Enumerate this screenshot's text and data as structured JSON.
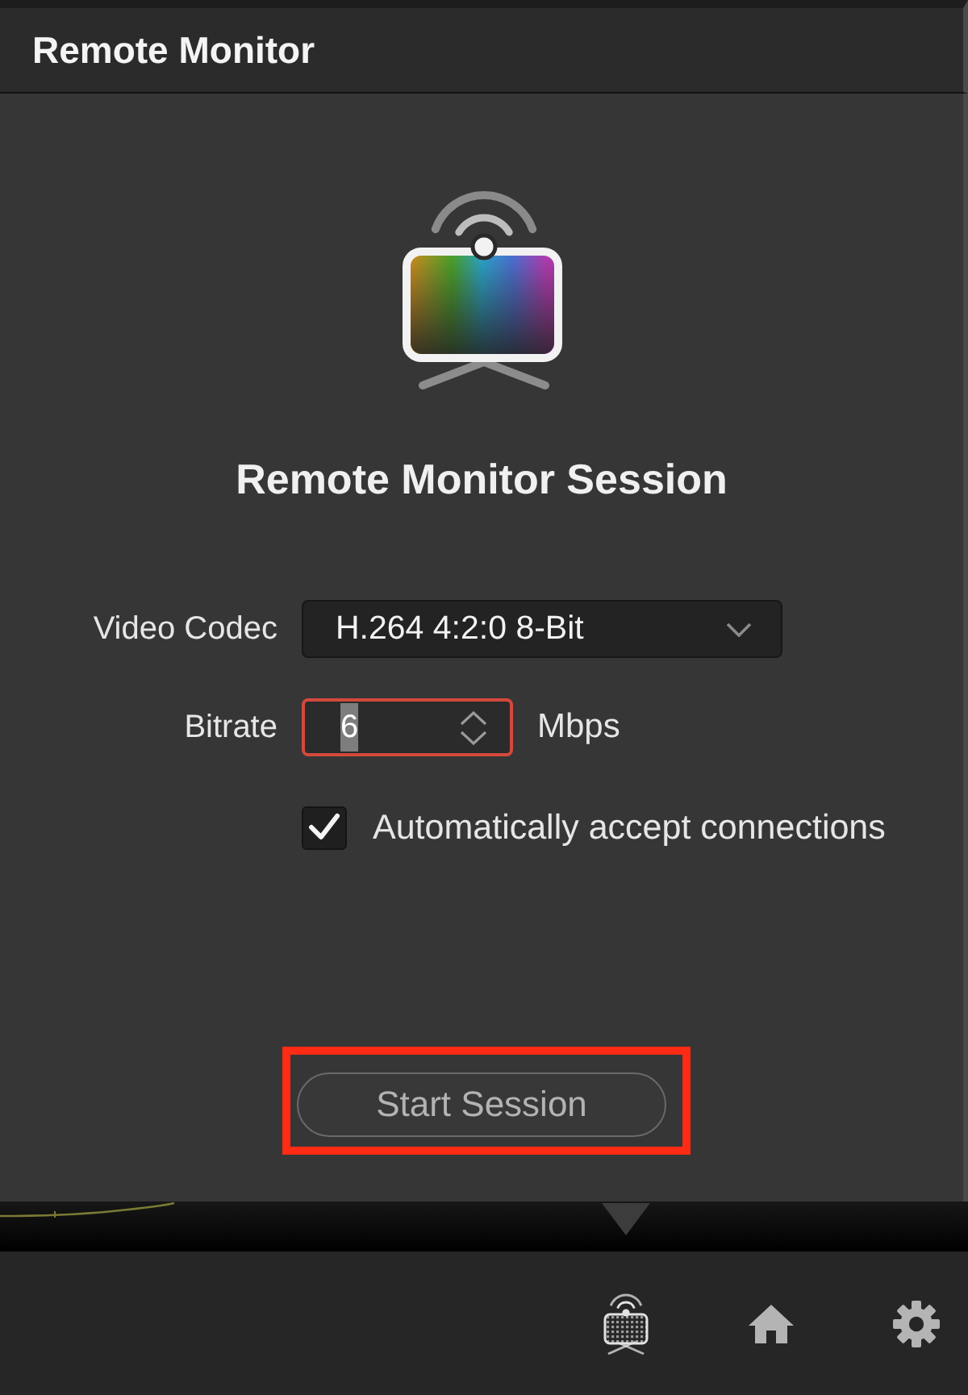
{
  "panel": {
    "title": "Remote Monitor",
    "heading": "Remote Monitor Session"
  },
  "fields": [
    {
      "kind": "select",
      "label": "Video Codec",
      "value": "H.264 4:2:0 8-Bit"
    },
    {
      "kind": "number",
      "label": "Bitrate",
      "value": "6",
      "unit": "Mbps",
      "focused": true
    }
  ],
  "options": [
    {
      "label": "Automatically accept connections",
      "checked": true
    }
  ],
  "start_button": {
    "label": "Start Session",
    "highlighted": true
  },
  "toolbar": [
    {
      "kind": "remote-monitor",
      "selected": true
    },
    {
      "kind": "home",
      "selected": false
    },
    {
      "kind": "settings",
      "selected": false
    }
  ]
}
